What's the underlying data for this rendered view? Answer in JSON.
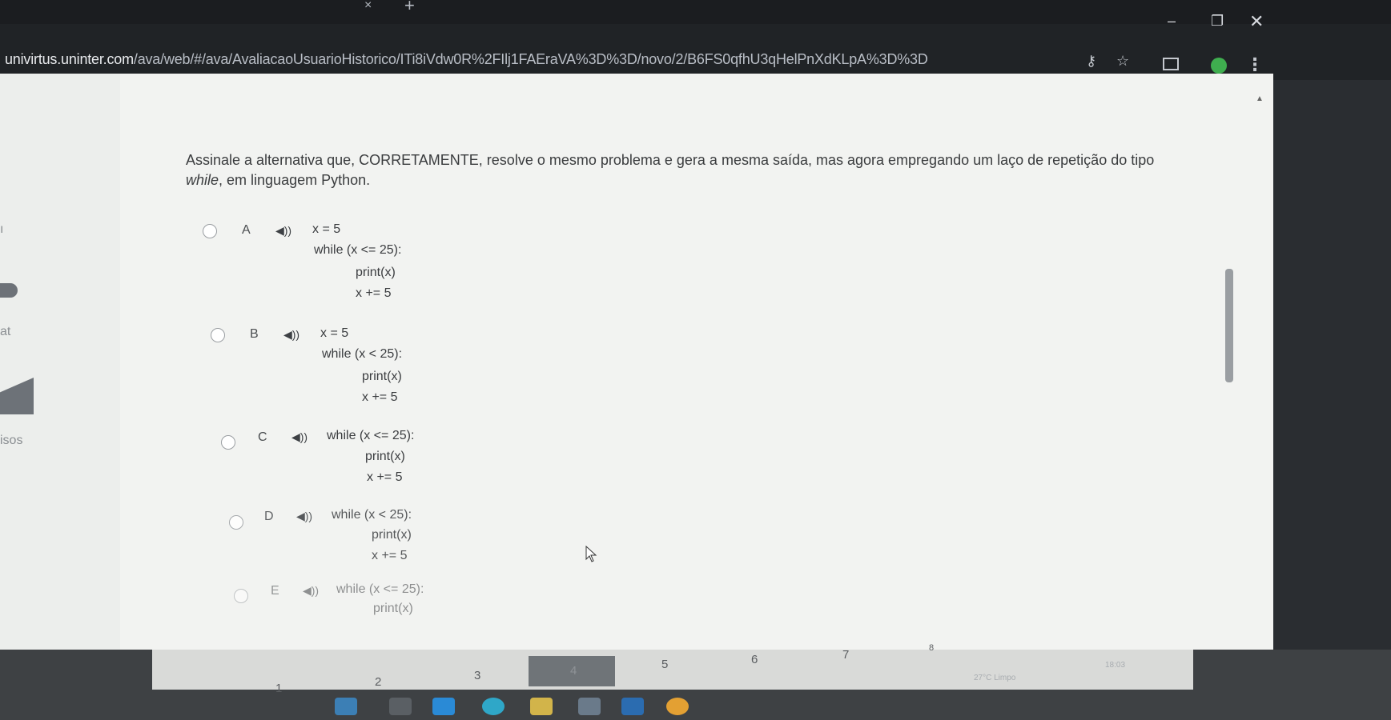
{
  "browser": {
    "url_host": "univirtus.uninter.com",
    "url_path": "/ava/web/#/ava/AvaliacaoUsuarioHistorico/ITi8iVdw0R%2FIlj1FAEraVA%3D%3D/novo/2/B6FS0qfhU3qHelPnXdKLpA%3D%3D",
    "tab_close": "×",
    "tab_new": "+",
    "icons": [
      "key-icon",
      "star-icon",
      "cast-icon",
      "profile-icon",
      "menu-icon"
    ],
    "window_buttons": {
      "minimize": "–",
      "maximize": "❐",
      "close": "✕"
    }
  },
  "left_rail": {
    "texts": [
      "ı",
      "at",
      "isos"
    ]
  },
  "question": {
    "part1": "Assinale a alternativa que, CORRETAMENTE, resolve o mesmo problema e gera a mesma saída, mas agora empregando um laço de repetição do tipo ",
    "keyword": "while",
    "part2": ", em linguagem Python."
  },
  "options": [
    {
      "letter": "A",
      "lines": [
        "x = 5",
        "while (x <= 25):",
        "print(x)",
        "x += 5"
      ]
    },
    {
      "letter": "B",
      "lines": [
        "x = 5",
        "while (x < 25):",
        "print(x)",
        "x += 5"
      ]
    },
    {
      "letter": "C",
      "lines": [
        "while (x <= 25):",
        "print(x)",
        "x += 5"
      ]
    },
    {
      "letter": "D",
      "lines": [
        "while (x < 25):",
        "print(x)",
        "x += 5"
      ]
    },
    {
      "letter": "E",
      "lines": [
        "while (x <= 25):",
        "print(x)"
      ]
    }
  ],
  "audio_icon_glyph": "◀))",
  "pager": [
    "1",
    "2",
    "3",
    "4",
    "5",
    "6",
    "7",
    "8"
  ],
  "tray": {
    "weather": "27°C Limpo",
    "time": "18:03"
  }
}
